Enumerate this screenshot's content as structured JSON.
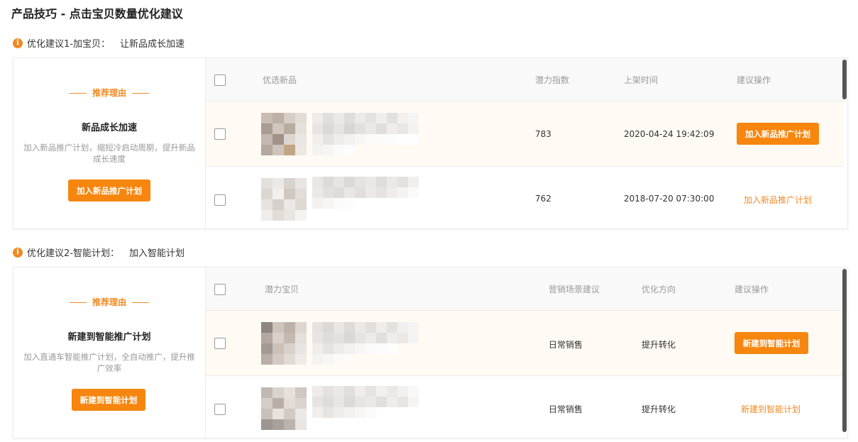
{
  "page": {
    "title": "产品技巧 - 点击宝贝数量优化建议"
  },
  "colors": {
    "accent": "#f7860f",
    "row_highlight": "#fffaf4"
  },
  "suggestion1": {
    "label": "优化建议1-加宝贝：",
    "summary": "让新品成长加速",
    "reason_title": "推荐理由",
    "heading": "新品成长加速",
    "description": "加入新品推广计划，缩短冷启动周期，提升新品成长速度",
    "button_label": "加入新品推广计划",
    "columns": [
      "优选新品",
      "潜力指数",
      "上架时间",
      "建议操作"
    ],
    "rows": [
      {
        "score": "783",
        "listed_at": "2020-04-24 19:42:09",
        "action": "加入新品推广计划",
        "highlighted": true
      },
      {
        "score": "762",
        "listed_at": "2018-07-20 07:30:00",
        "action": "加入新品推广计划",
        "highlighted": false
      }
    ]
  },
  "suggestion2": {
    "label": "优化建议2-智能计划：",
    "summary": "加入智能计划",
    "reason_title": "推荐理由",
    "heading": "新建到智能推广计划",
    "description": "加入直通车智能推广计划，全自动推广，提升推广效率",
    "button_label": "新建到智能计划",
    "columns": [
      "潜力宝贝",
      "营销场景建议",
      "优化方向",
      "建议操作"
    ],
    "rows": [
      {
        "scene": "日常销售",
        "direction": "提升转化",
        "action": "新建到智能计划",
        "highlighted": true
      },
      {
        "scene": "日常销售",
        "direction": "提升转化",
        "action": "新建到智能计划",
        "highlighted": false
      }
    ]
  },
  "icons": {
    "info": "info-icon",
    "checkbox": "checkbox-icon"
  }
}
